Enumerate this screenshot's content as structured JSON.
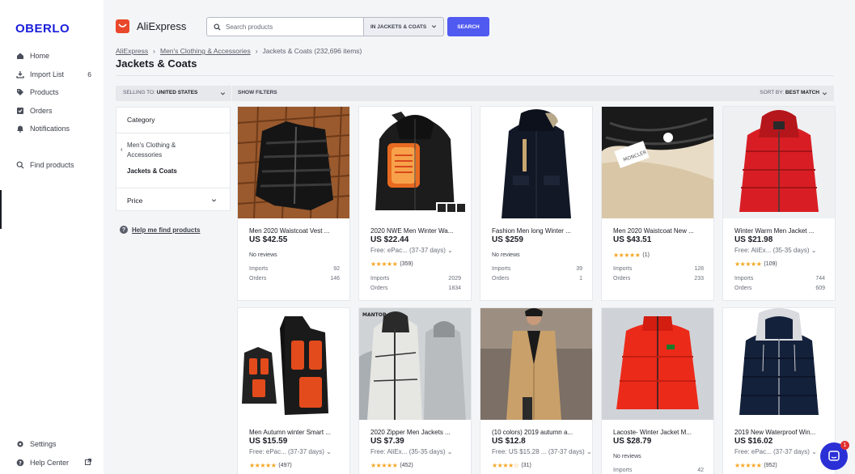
{
  "sidebar": {
    "logo": "OBERLO",
    "items": [
      {
        "label": "Home",
        "icon": "home-icon"
      },
      {
        "label": "Import List",
        "icon": "import-icon",
        "badge": "6"
      },
      {
        "label": "Products",
        "icon": "tag-icon"
      },
      {
        "label": "Orders",
        "icon": "orders-icon"
      },
      {
        "label": "Notifications",
        "icon": "bell-icon"
      }
    ],
    "find_products": "Find products",
    "settings": "Settings",
    "help_center": "Help Center"
  },
  "header": {
    "source_name": "AliExpress",
    "search_placeholder": "Search products",
    "scope": "IN JACKETS & COATS",
    "search_button": "SEARCH"
  },
  "breadcrumb": {
    "items": [
      "AliExpress",
      "Men's Clothing & Accessories",
      "Jackets & Coats (232,696 items)"
    ]
  },
  "page_title": "Jackets & Coats",
  "filterbar": {
    "selling_label": "SELLING TO:",
    "selling_value": "UNITED STATES",
    "show_filters": "SHOW FILTERS",
    "sort_label": "SORT BY:",
    "sort_value": "BEST MATCH"
  },
  "category_panel": {
    "heading": "Category",
    "parent": "Men's Clothing & Accessories",
    "current": "Jackets & Coats",
    "price": "Price"
  },
  "help_link": "Help me find products",
  "products": [
    {
      "name": "Men 2020 Waistcoat Vest ...",
      "price": "US $42.55",
      "reviews": "No reviews",
      "imports_label": "Imports",
      "imports": "92",
      "orders_label": "Orders",
      "orders": "146"
    },
    {
      "name": "2020 NWE Men Winter Wa...",
      "price": "US $22.44",
      "ship": "Free: ePac... (37-37 days)",
      "stars": "★★★★★",
      "reviews": "(359)",
      "imports_label": "Imports",
      "imports": "2029",
      "orders_label": "Orders",
      "orders": "1834"
    },
    {
      "name": "Fashion Men long Winter ...",
      "price": "US $259",
      "reviews": "No reviews",
      "imports_label": "Imports",
      "imports": "39",
      "orders_label": "Orders",
      "orders": "1"
    },
    {
      "name": "Men 2020 Waistcoat New ...",
      "price": "US $43.51",
      "stars": "★★★★★",
      "reviews": "(1)",
      "imports_label": "Imports",
      "imports": "128",
      "orders_label": "Orders",
      "orders": "233"
    },
    {
      "name": "Winter Warm Men Jacket ...",
      "price": "US $21.98",
      "ship": "Free: AliEx... (35-35 days)",
      "stars": "★★★★★",
      "reviews": "(109)",
      "imports_label": "Imports",
      "imports": "744",
      "orders_label": "Orders",
      "orders": "609"
    },
    {
      "name": "Men Autumn winter Smart ...",
      "price": "US $15.59",
      "ship": "Free: ePac... (37-37 days)",
      "stars": "★★★★★",
      "reviews": "(497)"
    },
    {
      "name": "2020 Zipper Men Jackets ...",
      "price": "US $7.39",
      "ship": "Free: AliEx... (35-35 days)",
      "stars": "★★★★★",
      "reviews": "(452)"
    },
    {
      "name": "(10 colors) 2019 autumn a...",
      "price": "US $12.8",
      "ship": "Free: US $15.28 ... (37-37 days)",
      "stars": "★★★★☆",
      "reviews": "(31)"
    },
    {
      "name": "Lacoste- Winter Jacket M...",
      "price": "US $28.79",
      "reviews": "No reviews",
      "imports_label": "Imports",
      "imports": "42"
    },
    {
      "name": "2019 New Waterproof Win...",
      "price": "US $16.02",
      "ship": "Free: ePac... (37-37 days)",
      "stars": "★★★★★",
      "reviews": "(952)"
    }
  ],
  "chat": {
    "badge": "1"
  }
}
